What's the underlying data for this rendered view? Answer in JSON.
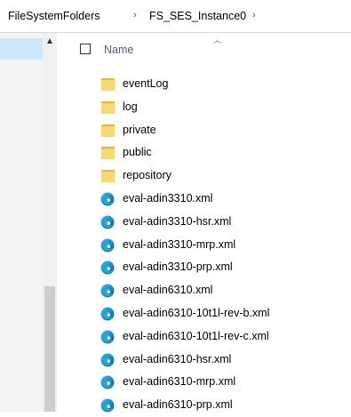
{
  "breadcrumb": {
    "items": [
      "FileSystemFolders",
      "FS_SES_Instance0"
    ],
    "separator": "›"
  },
  "header": {
    "name_label": "Name"
  },
  "files": [
    {
      "name": "eventLog",
      "type": "folder"
    },
    {
      "name": "log",
      "type": "folder"
    },
    {
      "name": "private",
      "type": "folder"
    },
    {
      "name": "public",
      "type": "folder"
    },
    {
      "name": "repository",
      "type": "folder"
    },
    {
      "name": "eval-adin3310.xml",
      "type": "xml"
    },
    {
      "name": "eval-adin3310-hsr.xml",
      "type": "xml"
    },
    {
      "name": "eval-adin3310-mrp.xml",
      "type": "xml"
    },
    {
      "name": "eval-adin3310-prp.xml",
      "type": "xml"
    },
    {
      "name": "eval-adin6310.xml",
      "type": "xml"
    },
    {
      "name": "eval-adin6310-10t1l-rev-b.xml",
      "type": "xml"
    },
    {
      "name": "eval-adin6310-10t1l-rev-c.xml",
      "type": "xml"
    },
    {
      "name": "eval-adin6310-hsr.xml",
      "type": "xml"
    },
    {
      "name": "eval-adin6310-mrp.xml",
      "type": "xml"
    },
    {
      "name": "eval-adin6310-prp.xml",
      "type": "xml"
    }
  ],
  "icons": {
    "folder": "folder-icon",
    "xml": "edge-xml-file-icon"
  },
  "colors": {
    "folder_yellow": "#f8d775",
    "edge_blue": "#0c59a4",
    "edge_green": "#32b858",
    "nav_selected": "#cce8ff"
  }
}
